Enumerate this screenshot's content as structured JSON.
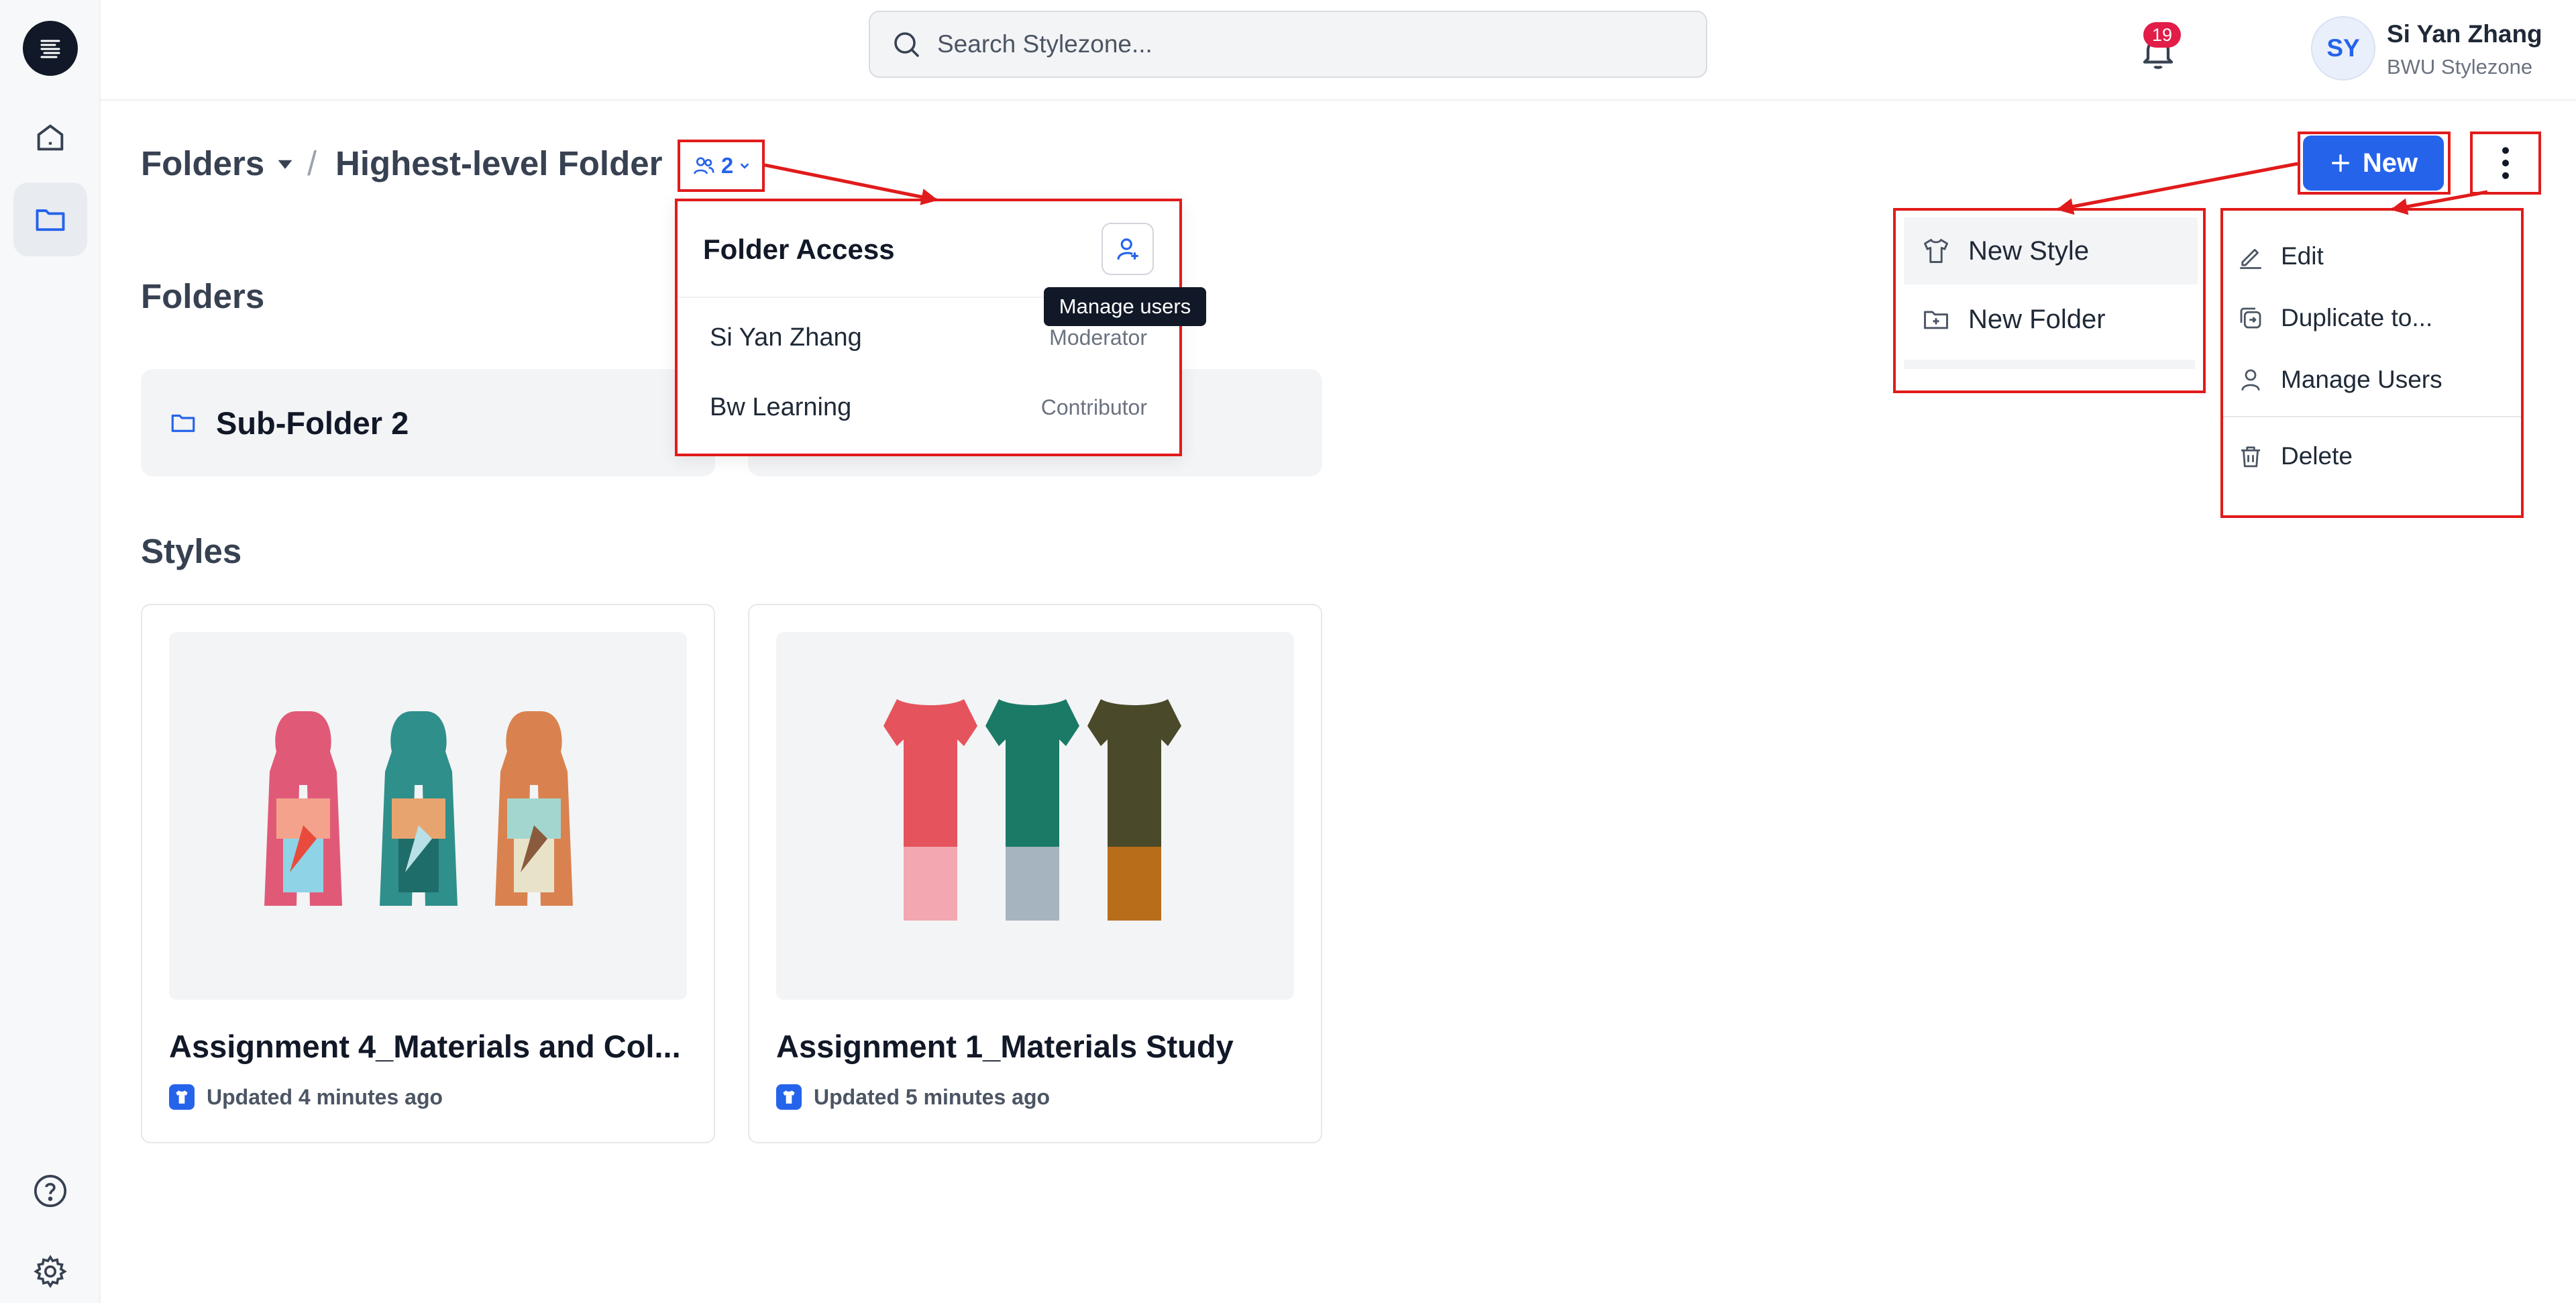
{
  "sidebar": {
    "items": [
      {
        "icon": "home-icon"
      },
      {
        "icon": "folder-icon",
        "active": true
      }
    ],
    "bottom": [
      {
        "icon": "help-icon"
      },
      {
        "icon": "gear-icon"
      }
    ]
  },
  "header": {
    "search_placeholder": "Search Stylezone...",
    "notification_count": "19",
    "user": {
      "initials": "SY",
      "name": "Si Yan Zhang",
      "org": "BWU Stylezone"
    }
  },
  "breadcrumb": {
    "root": "Folders",
    "separator": "/",
    "current": "Highest-level Folder",
    "access_count": "2"
  },
  "actions": {
    "new_label": "New"
  },
  "sections": {
    "folders_title": "Folders",
    "folders": [
      {
        "name": "Sub-Folder 2"
      }
    ],
    "styles_title": "Styles",
    "styles": [
      {
        "title": "Assignment 4_Materials and Col...",
        "updated": "Updated 4 minutes ago"
      },
      {
        "title": "Assignment 1_Materials Study",
        "updated": "Updated 5 minutes ago"
      }
    ]
  },
  "folder_access": {
    "title": "Folder Access",
    "tooltip": "Manage users",
    "members": [
      {
        "name": "Si Yan Zhang",
        "role": "Moderator"
      },
      {
        "name": "Bw Learning",
        "role": "Contributor"
      }
    ]
  },
  "new_menu": {
    "items": [
      {
        "label": "New Style",
        "icon": "shirt-icon"
      },
      {
        "label": "New Folder",
        "icon": "folder-plus-icon"
      }
    ]
  },
  "more_menu": {
    "items": [
      {
        "label": "Edit",
        "icon": "pencil-icon"
      },
      {
        "label": "Duplicate to...",
        "icon": "duplicate-icon"
      },
      {
        "label": "Manage Users",
        "icon": "user-icon"
      },
      {
        "label": "Delete",
        "icon": "trash-icon"
      }
    ]
  },
  "colors": {
    "accent": "#2563eb",
    "annotation": "#e11b1b",
    "badge": "#e11d48"
  }
}
